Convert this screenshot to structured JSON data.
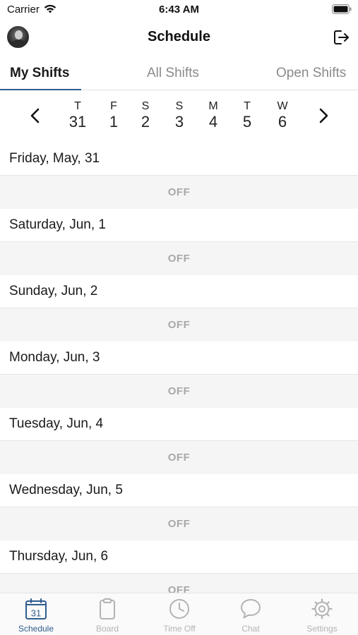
{
  "status_bar": {
    "carrier": "Carrier",
    "time": "6:43 AM"
  },
  "nav": {
    "title": "Schedule",
    "avatar_icon": "user-avatar",
    "logout_icon": "logout-icon"
  },
  "tabs": [
    {
      "label": "My Shifts",
      "active": true
    },
    {
      "label": "All Shifts",
      "active": false
    },
    {
      "label": "Open Shifts",
      "active": false
    }
  ],
  "week": {
    "prev_icon": "chevron-left-icon",
    "next_icon": "chevron-right-icon",
    "days": [
      {
        "dow": "T",
        "date": "31"
      },
      {
        "dow": "F",
        "date": "1"
      },
      {
        "dow": "S",
        "date": "2"
      },
      {
        "dow": "S",
        "date": "3"
      },
      {
        "dow": "M",
        "date": "4"
      },
      {
        "dow": "T",
        "date": "5"
      },
      {
        "dow": "W",
        "date": "6"
      }
    ]
  },
  "schedule": [
    {
      "day": "Friday, May, 31",
      "status": "OFF"
    },
    {
      "day": "Saturday, Jun, 1",
      "status": "OFF"
    },
    {
      "day": "Sunday, Jun, 2",
      "status": "OFF"
    },
    {
      "day": "Monday, Jun, 3",
      "status": "OFF"
    },
    {
      "day": "Tuesday, Jun, 4",
      "status": "OFF"
    },
    {
      "day": "Wednesday, Jun, 5",
      "status": "OFF"
    },
    {
      "day": "Thursday, Jun, 6",
      "status": "OFF"
    }
  ],
  "tab_bar": [
    {
      "label": "Schedule",
      "icon": "calendar-icon",
      "badge": "31",
      "active": true
    },
    {
      "label": "Board",
      "icon": "clipboard-icon",
      "active": false
    },
    {
      "label": "Time Off",
      "icon": "clock-icon",
      "active": false
    },
    {
      "label": "Chat",
      "icon": "chat-bubble-icon",
      "active": false
    },
    {
      "label": "Settings",
      "icon": "gear-icon",
      "active": false
    }
  ],
  "colors": {
    "accent": "#2e5d8e",
    "inactive": "#b3b3b3",
    "off_text": "#a8a8a8",
    "off_background": "#f5f5f5"
  }
}
